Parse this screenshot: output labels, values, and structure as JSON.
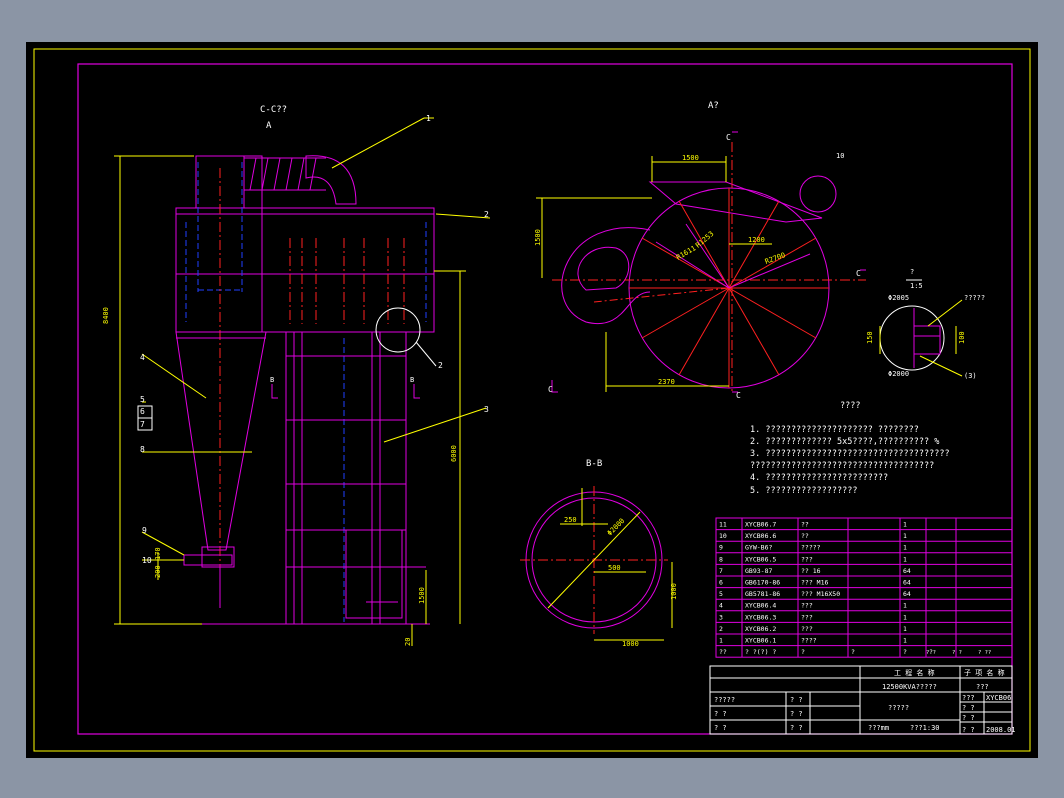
{
  "views": {
    "section_cc": "C-C??",
    "view_a_label": "A",
    "view_a_top": "A?",
    "section_bb": "B-B",
    "section_mark_c": "C",
    "section_mark_b": "B",
    "detail_num": "?",
    "detail_scale": "1:5"
  },
  "callouts": [
    "1",
    "2",
    "2",
    "3",
    "4",
    "5",
    "6",
    "7",
    "8",
    "9",
    "10",
    "10"
  ],
  "dims": {
    "total_height": "8400",
    "height_6000": "6000",
    "d_1500": "1500",
    "d_1500v": "1500",
    "d_1200": "1200",
    "d_2370": "2370",
    "r_1611": "R1611",
    "r_2700": "R2700",
    "r_1253": "R1253",
    "d_250": "250",
    "d_500": "500",
    "d_1000": "1000",
    "d_1000v": "1000",
    "d_2000": "Φ2000",
    "phi_2005": "Φ2005",
    "phi_2000": "Φ2000",
    "d_150": "150",
    "d_100": "100",
    "d_1500small": "1500",
    "d_20": "20",
    "d_200": "200",
    "d_170": "170",
    "detail_ref3": "(3)",
    "detail_note": "?????"
  },
  "notes": {
    "title": "????",
    "lines": [
      "1. ?????????????????????    ????????",
      "2. ?????????????    5x5????,??????????      %",
      "3. ????????????????????????????????????",
      "   ????????????????????????????????????",
      "4. ????????????????????????",
      "5. ??????????????????"
    ]
  },
  "bom": {
    "rows": [
      [
        "11",
        "XYCB06.7",
        "??",
        "",
        "1",
        ""
      ],
      [
        "10",
        "XYCB06.6",
        "??",
        "",
        "1",
        ""
      ],
      [
        "9",
        "GYW-B6?",
        "?????",
        "",
        "1",
        ""
      ],
      [
        "8",
        "XYCB06.5",
        "???",
        "",
        "1",
        ""
      ],
      [
        "7",
        "GB93-87",
        "??    16",
        "",
        "64",
        ""
      ],
      [
        "6",
        "GB6170-86",
        "???   M16",
        "",
        "64",
        ""
      ],
      [
        "5",
        "GB5781-86",
        "???  M16X50",
        "",
        "64",
        ""
      ],
      [
        "4",
        "XYCB06.4",
        "???",
        "",
        "1",
        ""
      ],
      [
        "3",
        "XYCB06.3",
        "???",
        "",
        "1",
        ""
      ],
      [
        "2",
        "XYCB06.2",
        "???",
        "",
        "1",
        ""
      ],
      [
        "1",
        "XYCB06.1",
        "????",
        "",
        "1",
        ""
      ]
    ],
    "header": [
      "??",
      "?  ?(?)  ?",
      "?",
      "?",
      "?",
      "?"
    ],
    "header_extra": [
      "?  ?",
      "?  ?",
      "? ??"
    ]
  },
  "title_block": {
    "project_label": "工  程  名  称",
    "subitem_label": "子 项 名 称",
    "project_name": "12500KVA?????",
    "subitem_name": "???",
    "drawing_title": "?????",
    "units": "???mm",
    "scale": "???1:30",
    "drawing_no_label": "???",
    "drawing_no": "XYCB06",
    "date": "2008.01",
    "left_rows": [
      [
        "?????",
        "?  ?"
      ],
      [
        "?  ?",
        "?  ?"
      ],
      [
        "?  ?",
        "?  ?"
      ]
    ],
    "right_small": [
      [
        "?  ?",
        ""
      ],
      [
        "?  ?",
        ""
      ],
      [
        "?  ?",
        ""
      ],
      [
        "?  ?",
        ""
      ]
    ]
  },
  "colors": {
    "frame": "#e000e0",
    "outer_frame": "#ffff00",
    "outline": "#e000e0",
    "dim": "#ffff00",
    "hidden": "#2040ff",
    "center": "#ff2020",
    "text": "#ffffff"
  }
}
